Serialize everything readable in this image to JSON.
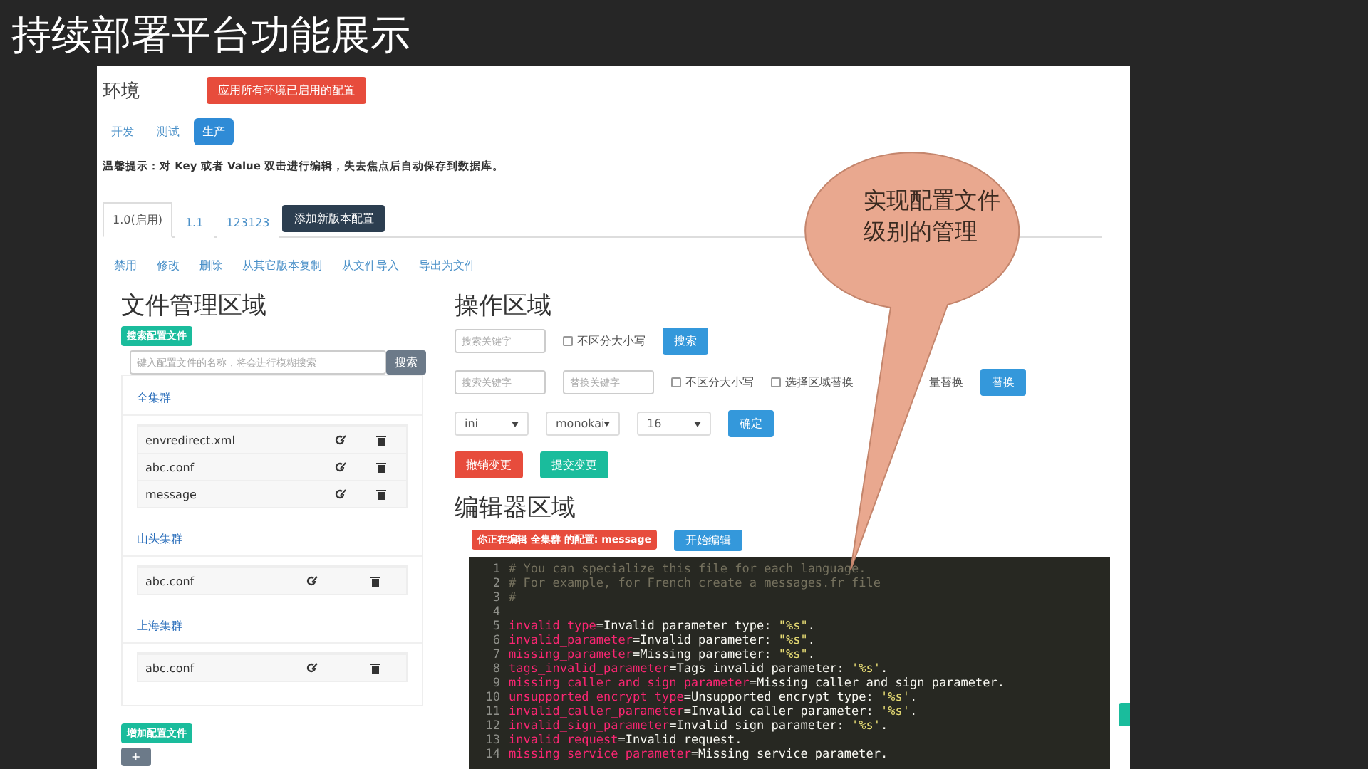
{
  "slide_title": "持续部署平台功能展示",
  "screenshot": {
    "env_label": "环境",
    "apply_button": "应用所有环境已启用的配置",
    "env_tabs": [
      {
        "label": "开发",
        "selected": false
      },
      {
        "label": "测试",
        "selected": false
      },
      {
        "label": "生产",
        "selected": true
      }
    ],
    "hint": "温馨提示：对 Key 或者 Value 双击进行编辑，失去焦点后自动保存到数据库。",
    "version_tabs": [
      {
        "label": "1.0(启用)",
        "selected": true
      },
      {
        "label": "1.1",
        "selected": false
      },
      {
        "label": "123123",
        "selected": false
      }
    ],
    "add_version_button": "添加新版本配置",
    "actions": [
      "禁用",
      "修改",
      "删除",
      "从其它版本复制",
      "从文件导入",
      "导出为文件"
    ],
    "file_area": {
      "title": "文件管理区域",
      "search_label": "搜索配置文件",
      "search_placeholder": "键入配置文件的名称，将会进行模糊搜索",
      "search_button": "搜索",
      "groups": [
        {
          "name": "全集群",
          "files": [
            "envredirect.xml",
            "abc.conf",
            "message"
          ]
        },
        {
          "name": "山头集群",
          "files": [
            "abc.conf"
          ]
        },
        {
          "name": "上海集群",
          "files": [
            "abc.conf"
          ]
        }
      ],
      "add_label": "增加配置文件",
      "add_button": "+"
    },
    "operation_area": {
      "title": "操作区域",
      "search_placeholder": "搜索关键字",
      "case_check": {
        "label": "不区分大小写",
        "checked": false
      },
      "search_button": "搜索",
      "replace_search_placeholder": "搜索关键字",
      "replace_placeholder": "替换关键字",
      "replace_case_check": {
        "label": "不区分大小写",
        "checked": false
      },
      "region_check": {
        "label": "选择区域替换",
        "checked": false
      },
      "all_label": "量替换",
      "replace_button": "替换",
      "selects": [
        "ini",
        "monokai",
        "16"
      ],
      "confirm_button": "确定",
      "revert_button": "撤销变更",
      "commit_button": "提交变更"
    },
    "editor_area": {
      "title": "编辑器区域",
      "editing_label": "你正在编辑 全集群 的配置: message",
      "start_button": "开始编辑",
      "lines": [
        {
          "n": "1",
          "kind": "comment",
          "text": "# You can specialize this file for each language."
        },
        {
          "n": "2",
          "kind": "comment",
          "text": "# For example, for French create a messages.fr file"
        },
        {
          "n": "3",
          "kind": "comment",
          "text": "#"
        },
        {
          "n": "4",
          "kind": "blank"
        },
        {
          "n": "5",
          "kind": "pair",
          "key": "invalid_type",
          "text": "=Invalid parameter type: ",
          "str": "\"%s\"",
          "tail": "."
        },
        {
          "n": "6",
          "kind": "pair",
          "key": "invalid_parameter",
          "text": "=Invalid parameter: ",
          "str": "\"%s\"",
          "tail": "."
        },
        {
          "n": "7",
          "kind": "pair",
          "key": "missing_parameter",
          "text": "=Missing parameter: ",
          "str": "\"%s\"",
          "tail": "."
        },
        {
          "n": "8",
          "kind": "pair",
          "key": "tags_invalid_parameter",
          "text": "=Tags invalid parameter: ",
          "str": "'%s'",
          "tail": "."
        },
        {
          "n": "9",
          "kind": "pair",
          "key": "missing_caller_and_sign_parameter",
          "text": "=Missing caller and sign parameter."
        },
        {
          "n": "10",
          "kind": "pair",
          "key": "unsupported_encrypt_type",
          "text": "=Unsupported encrypt type: ",
          "str": "'%s'",
          "tail": "."
        },
        {
          "n": "11",
          "kind": "pair",
          "key": "invalid_caller_parameter",
          "text": "=Invalid caller parameter: ",
          "str": "'%s'",
          "tail": "."
        },
        {
          "n": "12",
          "kind": "pair",
          "key": "invalid_sign_parameter",
          "text": "=Invalid sign parameter: ",
          "str": "'%s'",
          "tail": "."
        },
        {
          "n": "13",
          "kind": "pair",
          "key": "invalid_request",
          "text": "=Invalid request."
        },
        {
          "n": "14",
          "kind": "pair",
          "key": "missing_service_parameter",
          "text": "=Missing service parameter."
        }
      ]
    }
  },
  "callout": [
    "实现配置文件",
    "级别的管理"
  ]
}
